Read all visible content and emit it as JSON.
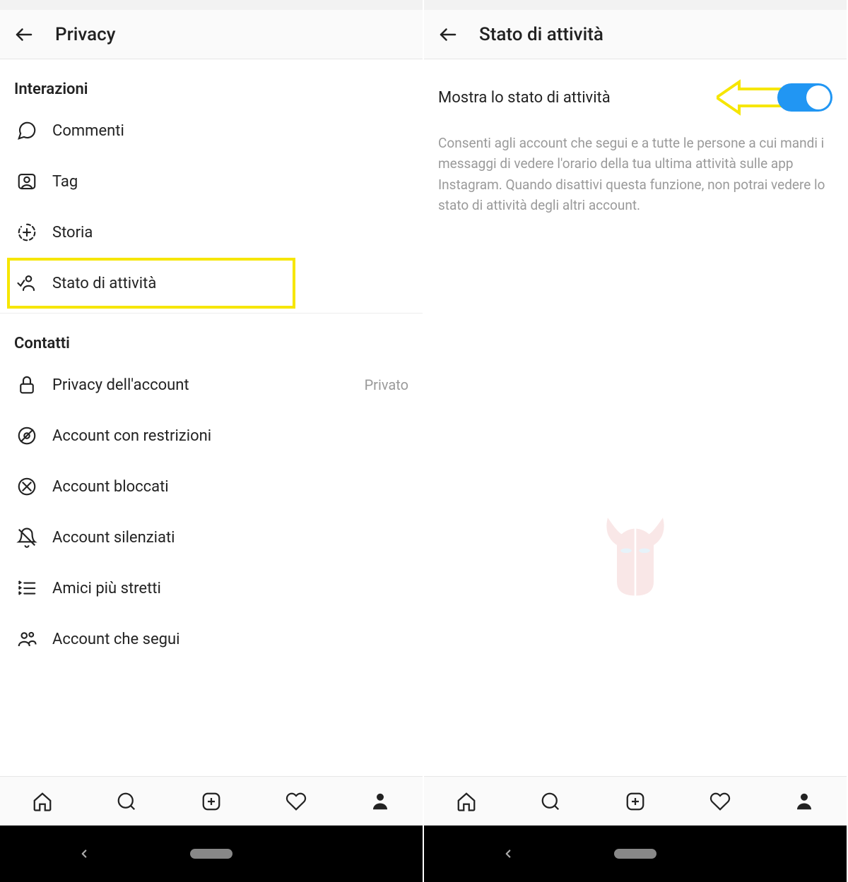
{
  "left": {
    "header_title": "Privacy",
    "section_interactions": "Interazioni",
    "items_interactions": [
      {
        "label": "Commenti"
      },
      {
        "label": "Tag"
      },
      {
        "label": "Storia"
      },
      {
        "label": "Stato di attività"
      }
    ],
    "section_contacts": "Contatti",
    "items_contacts": [
      {
        "label": "Privacy dell'account",
        "trail": "Privato"
      },
      {
        "label": "Account con restrizioni"
      },
      {
        "label": "Account bloccati"
      },
      {
        "label": "Account silenziati"
      },
      {
        "label": "Amici più stretti"
      },
      {
        "label": "Account che segui"
      }
    ]
  },
  "right": {
    "header_title": "Stato di attività",
    "toggle_label": "Mostra lo stato di attività",
    "toggle_on": true,
    "description": "Consenti agli account che segui e a tutte le persone a cui mandi i messaggi di vedere l'orario della tua ultima attività sulle app Instagram. Quando disattivi questa funzione, non potrai vedere lo stato di attività degli altri account."
  },
  "colors": {
    "highlight": "#f6e600",
    "toggle_on": "#2196f3"
  }
}
